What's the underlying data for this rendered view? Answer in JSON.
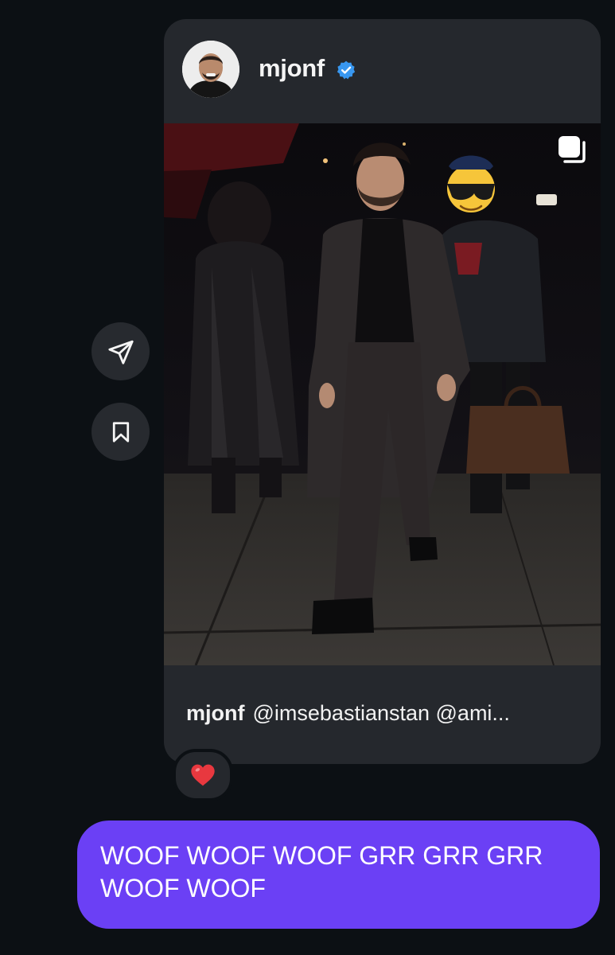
{
  "post": {
    "username": "mjonf",
    "verified": true,
    "caption_user": "mjonf",
    "caption_text": "@imsebastianstan @ami...",
    "multi_image": true,
    "avatar_icon": "person-avatar",
    "image_icon": "photo"
  },
  "actions": {
    "share_icon": "paper-plane-icon",
    "save_icon": "bookmark-icon"
  },
  "reaction": {
    "emoji": "❤️"
  },
  "message": {
    "text": "WOOF WOOF WOOF GRR GRR GRR WOOF WOOF"
  },
  "colors": {
    "background": "#0c1014",
    "card": "#25282d",
    "bubble": "#6b40f5",
    "verified": "#3897f0"
  }
}
